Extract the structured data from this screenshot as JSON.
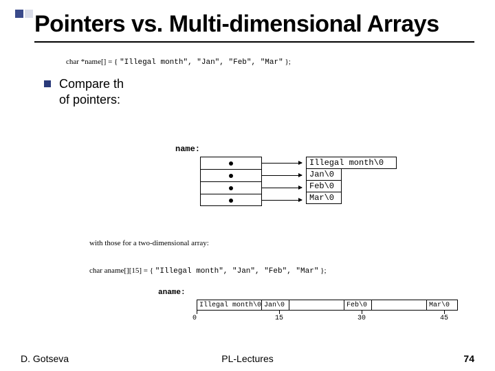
{
  "title": "Pointers vs. Multi-dimensional Arrays",
  "code1_prefix": "char *name[] = { ",
  "code1_body": "\"Illegal month\", \"Jan\", \"Feb\", \"Mar\"",
  "code1_suffix": " };",
  "bullet_text_l1": "Compare th",
  "bullet_text_l2": "of pointers:",
  "diagram1": {
    "label": "name:",
    "strings": [
      "Illegal month\\0",
      "Jan\\0",
      "Feb\\0",
      "Mar\\0"
    ]
  },
  "caption": "with those for a two-dimensional array:",
  "code2_prefix": "char aname[][15] = { ",
  "code2_body": "\"Illegal month\", \"Jan\", \"Feb\", \"Mar\"",
  "code2_suffix": " };",
  "diagram2": {
    "label": "aname:",
    "segs": [
      "Illegal month\\0",
      "Jan\\0",
      "",
      "Feb\\0",
      "",
      "Mar\\0",
      ""
    ],
    "ticks": [
      {
        "pos": 0,
        "label": "0"
      },
      {
        "pos": 120,
        "label": "15"
      },
      {
        "pos": 240,
        "label": "30"
      },
      {
        "pos": 360,
        "label": "45"
      }
    ]
  },
  "footer": {
    "author": "D. Gotseva",
    "center": "PL-Lectures",
    "page": "74"
  }
}
